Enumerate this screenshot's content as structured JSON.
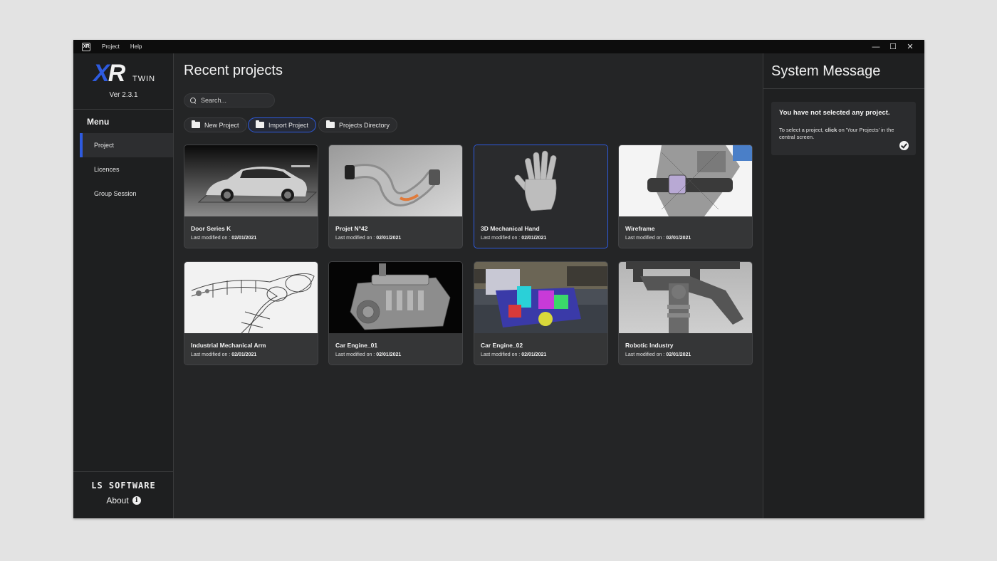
{
  "titlebar": {
    "logo": "XR",
    "menu": [
      "Project",
      "Help"
    ],
    "controls": {
      "minimize": "—",
      "maximize": "☐",
      "close": "✕"
    }
  },
  "sidebar": {
    "logo_xr": "XR",
    "logo_twin": "TWIN",
    "version": "Ver 2.3.1",
    "menu_title": "Menu",
    "items": [
      {
        "label": "Project",
        "active": true
      },
      {
        "label": "Licences",
        "active": false
      },
      {
        "label": "Group Session",
        "active": false
      }
    ],
    "company": "LS SOFTWARE",
    "about": "About"
  },
  "main": {
    "title": "Recent projects",
    "search_placeholder": "Search...",
    "actions": [
      "New Project",
      "Import Project",
      "Projects Directory"
    ],
    "modified_prefix": "Last modified on :",
    "projects": [
      {
        "title": "Door Series K",
        "date": "02/01/2021",
        "thumb": "car"
      },
      {
        "title": "Projet N°42",
        "date": "02/01/2021",
        "thumb": "tube"
      },
      {
        "title": "3D Mechanical Hand",
        "date": "02/01/2021",
        "thumb": "hand",
        "selected": true
      },
      {
        "title": "Wireframe",
        "date": "02/01/2021",
        "thumb": "wireframe"
      },
      {
        "title": "Industrial Mechanical Arm",
        "date": "02/01/2021",
        "thumb": "arm"
      },
      {
        "title": "Car Engine_01",
        "date": "02/01/2021",
        "thumb": "engine"
      },
      {
        "title": "Car Engine_02",
        "date": "02/01/2021",
        "thumb": "engine-color"
      },
      {
        "title": "Robotic Industry",
        "date": "02/01/2021",
        "thumb": "robot"
      }
    ]
  },
  "system": {
    "title": "System Message",
    "message_title": "You have not selected any project.",
    "message_pre": "To select a project, ",
    "message_bold": "click",
    "message_post": " on 'Your Projects' in the central screen."
  },
  "colors": {
    "accent": "#2e5be0",
    "background": "#242526",
    "sidebar": "#1e1f20"
  }
}
